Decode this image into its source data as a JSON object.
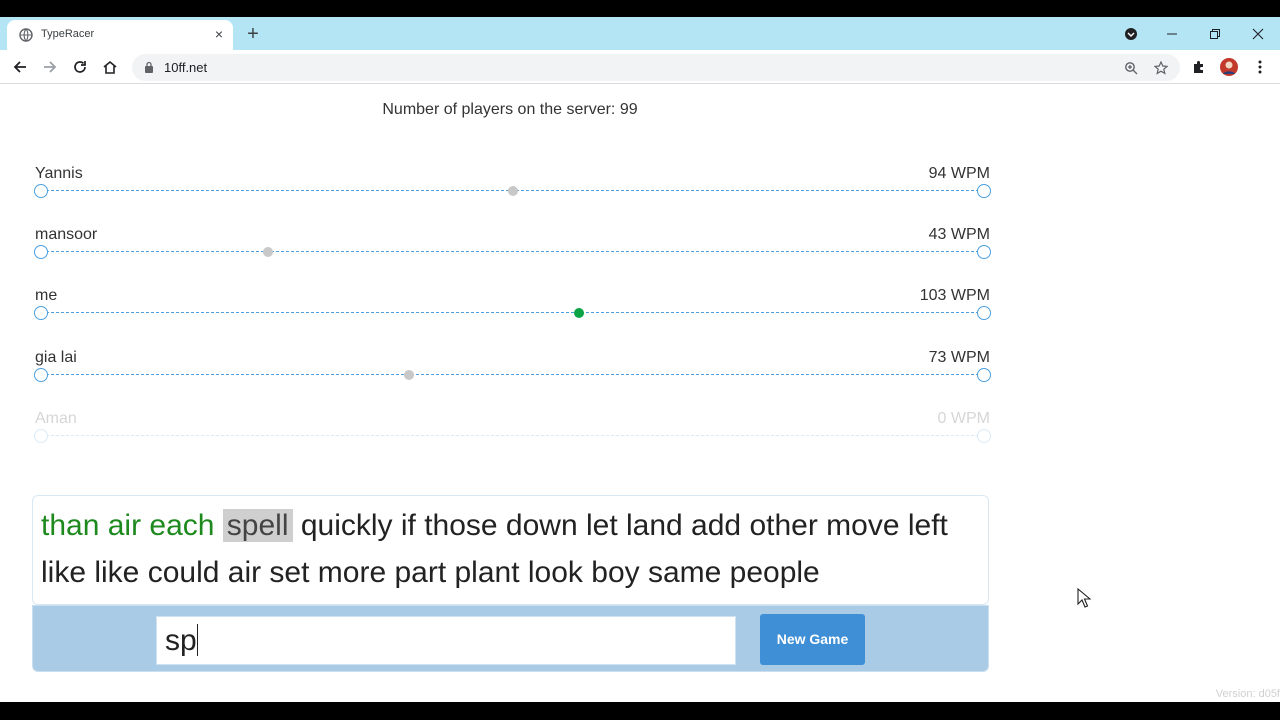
{
  "browser": {
    "tab_title": "TypeRacer",
    "url": "10ff.net",
    "new_tab_symbol": "+",
    "close_symbol": "×"
  },
  "page": {
    "players_count_text": "Number of players on the server: 99",
    "racers": [
      {
        "name": "Yannis",
        "wpm": "94 WPM",
        "progress": 0.5,
        "is_me": false,
        "inactive": false
      },
      {
        "name": "mansoor",
        "wpm": "43 WPM",
        "progress": 0.24,
        "is_me": false,
        "inactive": false
      },
      {
        "name": "me",
        "wpm": "103 WPM",
        "progress": 0.57,
        "is_me": true,
        "inactive": false
      },
      {
        "name": "gia lai",
        "wpm": "73 WPM",
        "progress": 0.39,
        "is_me": false,
        "inactive": false
      },
      {
        "name": "Aman",
        "wpm": "0 WPM",
        "progress": 0.0,
        "is_me": false,
        "inactive": true
      }
    ],
    "text_typed": "than air each ",
    "text_current": "spell",
    "text_rest": " quickly if those down let land add other move left like like could air set more part plant look boy same people",
    "input_value": "sp",
    "new_game_label": "New Game",
    "version_text": "Version: d05f"
  },
  "colors": {
    "tab_strip": "#b3e5f5",
    "track": "#4a9fe0",
    "me_car": "#0aa445",
    "other_car": "#c8c8c8",
    "typed_text": "#1e8a1e",
    "new_game_button": "#3f8fd6"
  }
}
